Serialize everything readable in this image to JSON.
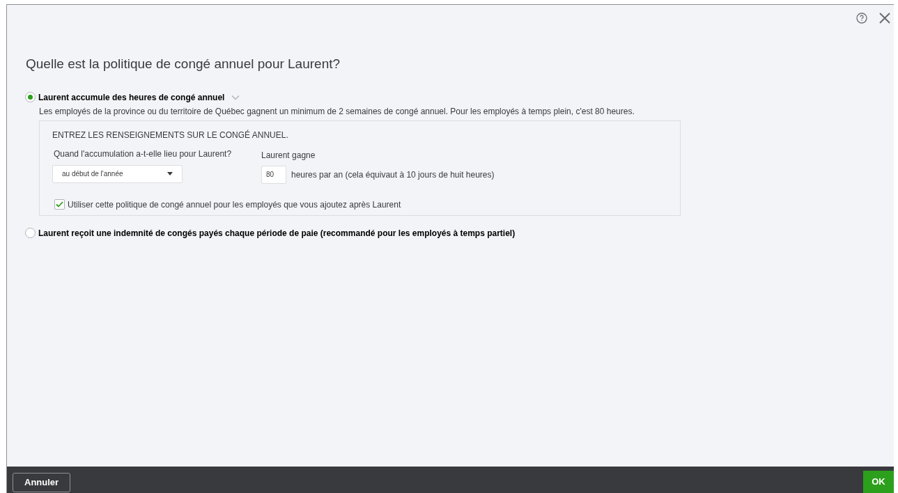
{
  "title": "Quelle est la politique de congé annuel pour Laurent?",
  "options": [
    {
      "label": "Laurent accumule des heures de congé annuel",
      "selected": true,
      "expanded": true,
      "description": "Les employés de la province ou du territoire de Québec gagnent un minimum de 2 semaines de congé annuel. Pour les employés à temps plein, c'est 80 heures.",
      "details": {
        "heading": "ENTREZ LES RENSEIGNEMENTS SUR LE CONGÉ ANNUEL.",
        "accrual_label": "Quand l'accumulation a-t-elle lieu pour Laurent?",
        "accrual_value": "au début de l'année",
        "earns_label": "Laurent gagne",
        "hours_value": "80",
        "hours_suffix": "heures par an (cela équivaut à 10 jours de huit heures)",
        "checkbox": {
          "label": "Utiliser cette politique de congé annuel pour les employés que vous ajoutez après Laurent",
          "checked": true
        }
      }
    },
    {
      "label": "Laurent reçoit une indemnité de congés payés chaque période de paie (recommandé pour les employés à temps partiel)",
      "selected": false
    }
  ],
  "footer": {
    "cancel": "Annuler",
    "ok": "OK"
  }
}
